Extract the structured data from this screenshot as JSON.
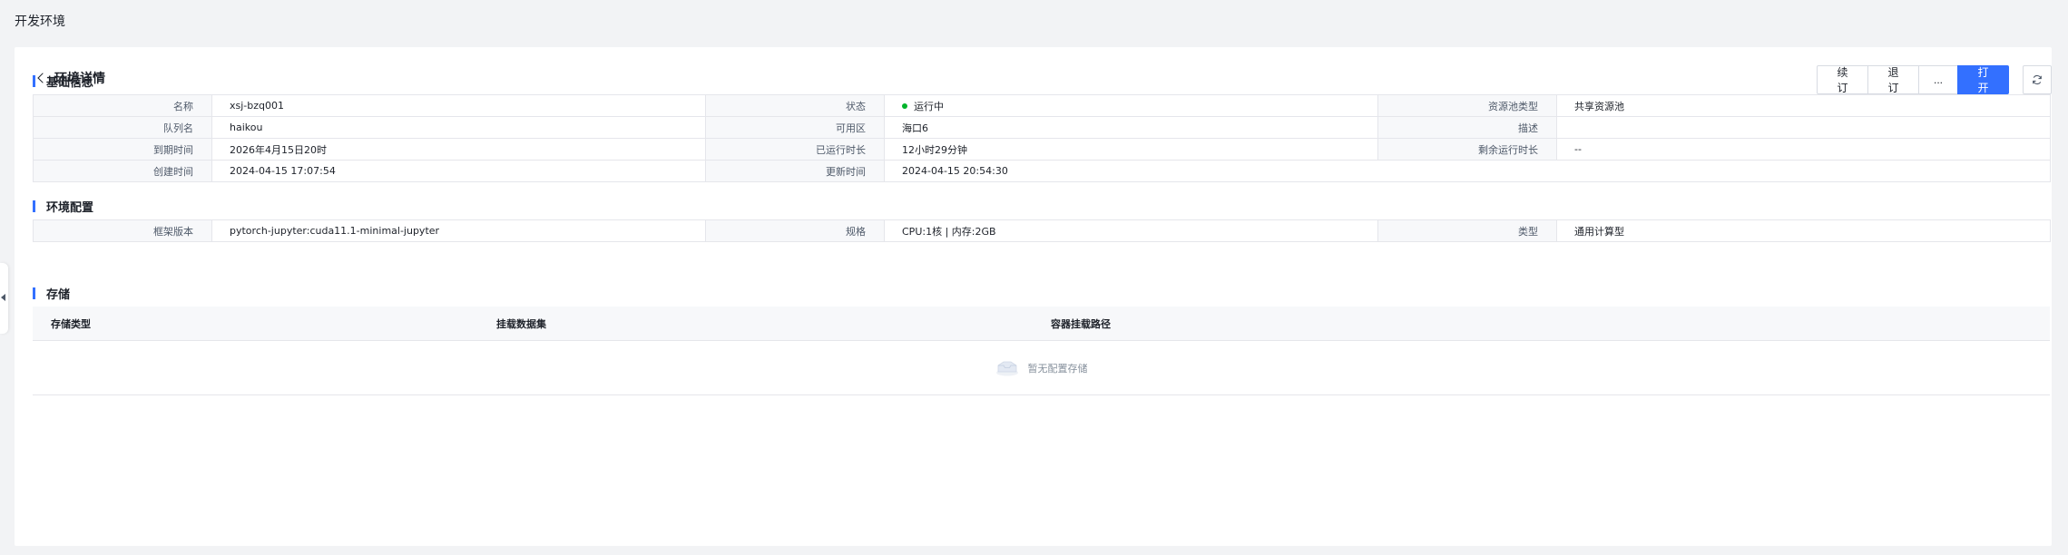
{
  "header": {
    "title": "开发环境"
  },
  "detail": {
    "title": "环境详情",
    "actions": {
      "renew": "续订",
      "unsubscribe": "退订",
      "more": "...",
      "open": "打开"
    }
  },
  "basic": {
    "title": "基础信息",
    "rows": [
      [
        {
          "k": "名称",
          "v": "xsj-bzq001"
        },
        {
          "k": "状态",
          "v": "运行中"
        },
        {
          "k": "资源池类型",
          "v": "共享资源池"
        }
      ],
      [
        {
          "k": "队列名",
          "v": "haikou"
        },
        {
          "k": "可用区",
          "v": "海口6"
        },
        {
          "k": "描述",
          "v": ""
        }
      ],
      [
        {
          "k": "到期时间",
          "v": "2026年4月15日20时"
        },
        {
          "k": "已运行时长",
          "v": "12小时29分钟"
        },
        {
          "k": "剩余运行时长",
          "v": "--"
        }
      ],
      [
        {
          "k": "创建时间",
          "v": "2024-04-15 17:07:54"
        },
        {
          "k": "更新时间",
          "v": "2024-04-15 20:54:30"
        }
      ]
    ]
  },
  "config": {
    "title": "环境配置",
    "rows": [
      [
        {
          "k": "框架版本",
          "v": "pytorch-jupyter:cuda11.1-minimal-jupyter"
        },
        {
          "k": "规格",
          "v": "CPU:1核 | 内存:2GB"
        },
        {
          "k": "类型",
          "v": "通用计算型"
        }
      ]
    ]
  },
  "storage": {
    "title": "存储",
    "columns": [
      "存储类型",
      "挂载数据集",
      "容器挂载路径"
    ],
    "empty_text": "暂无配置存储"
  },
  "colors": {
    "accent": "#3370ff",
    "running": "#00b42a"
  }
}
